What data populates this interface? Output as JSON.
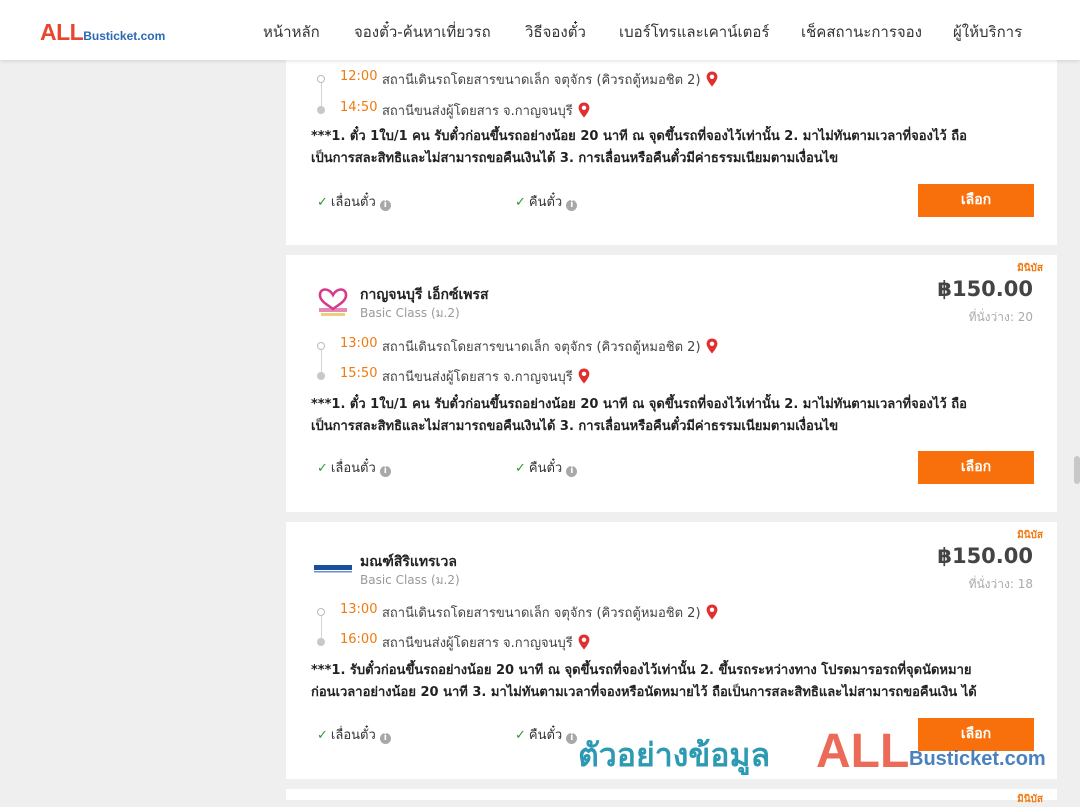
{
  "logo": {
    "big": "ALL",
    "small": "Busticket.com"
  },
  "nav": [
    "หน้าหลัก",
    "จองตั๋ว-ค้นหาเที่ยวรถ",
    "วิธีจองตั๋ว",
    "เบอร์โทรและเคาน์เตอร์",
    "เช็คสถานะการจอง",
    "ผู้ให้บริการ"
  ],
  "cards": [
    {
      "stops": [
        {
          "time": "12:00",
          "place": "สถานีเดินรถโดยสารขนาดเล็ก จตุจักร (คิวรถตู้หมอชิต 2)"
        },
        {
          "time": "14:50",
          "place": "สถานีขนส่งผู้โดยสาร จ.กาญจนบุรี"
        }
      ],
      "note": [
        "***1. ตั๋ว 1ใบ/1 คน รับตั๋วก่อนขึ้นรถอย่างน้อย 20 นาที ณ จุดขึ้นรถที่จองไว้เท่านั้น 2. มาไม่ทันตามเวลาที่จองไว้ ถือ",
        "เป็นการสละสิทธิและไม่สามารถขอคืนเงินได้ 3. การเลื่อนหรือคืนตั๋วมีค่าธรรมเนียมตามเงื่อนไข"
      ],
      "feature1": "เลื่อนตั๋ว",
      "feature2": "คืนตั๋ว",
      "button": "เลือก"
    },
    {
      "badge": "มินิบัส",
      "operator": "กาญจนบุรี เอ็กซ์เพรส",
      "logo_text": "กาญจนบุรี เอ็กซ์เพรส",
      "class": "Basic Class (ม.2)",
      "price": "฿150.00",
      "seats": "ที่นั่งว่าง: 20",
      "stops": [
        {
          "time": "13:00",
          "place": "สถานีเดินรถโดยสารขนาดเล็ก จตุจักร (คิวรถตู้หมอชิต 2)"
        },
        {
          "time": "15:50",
          "place": "สถานีขนส่งผู้โดยสาร จ.กาญจนบุรี"
        }
      ],
      "note": [
        "***1. ตั๋ว 1ใบ/1 คน รับตั๋วก่อนขึ้นรถอย่างน้อย 20 นาที ณ จุดขึ้นรถที่จองไว้เท่านั้น 2. มาไม่ทันตามเวลาที่จองไว้ ถือ",
        "เป็นการสละสิทธิและไม่สามารถขอคืนเงินได้ 3. การเลื่อนหรือคืนตั๋วมีค่าธรรมเนียมตามเงื่อนไข"
      ],
      "feature1": "เลื่อนตั๋ว",
      "feature2": "คืนตั๋ว",
      "button": "เลือก"
    },
    {
      "badge": "มินิบัส",
      "operator": "มณฑ์สิริแทรเวล",
      "logo_text": "มณฑ์สิริ แทรเวล",
      "class": "Basic Class (ม.2)",
      "price": "฿150.00",
      "seats": "ที่นั่งว่าง: 18",
      "stops": [
        {
          "time": "13:00",
          "place": "สถานีเดินรถโดยสารขนาดเล็ก จตุจักร (คิวรถตู้หมอชิต 2)"
        },
        {
          "time": "16:00",
          "place": "สถานีขนส่งผู้โดยสาร จ.กาญจนบุรี"
        }
      ],
      "note": [
        "***1. รับตั๋วก่อนขึ้นรถอย่างน้อย 20 นาที ณ จุดขึ้นรถที่จองไว้เท่านั้น 2. ขึ้นรถระหว่างทาง โปรดมารอรถที่จุดนัดหมาย",
        "ก่อนเวลาอย่างน้อย 20 นาที 3. มาไม่ทันตามเวลาที่จองหรือนัดหมายไว้ ถือเป็นการสละสิทธิและไม่สามารถขอคืนเงิน ได้"
      ],
      "feature1": "เลื่อนตั๋ว",
      "feature2": "คืนตั๋ว",
      "button": "เลือก"
    },
    {
      "badge": "มินิบัส"
    }
  ],
  "watermark": {
    "thai": "ตัวอย่างข้อมูล",
    "big": "ALL",
    "small": "Busticket.com"
  },
  "colors": {
    "accent": "#f7700c",
    "time": "#f07a10",
    "logo_red": "#e8472f",
    "logo_blue": "#2a6ab3",
    "pin": "#e03030",
    "check": "#2a9a2a"
  }
}
